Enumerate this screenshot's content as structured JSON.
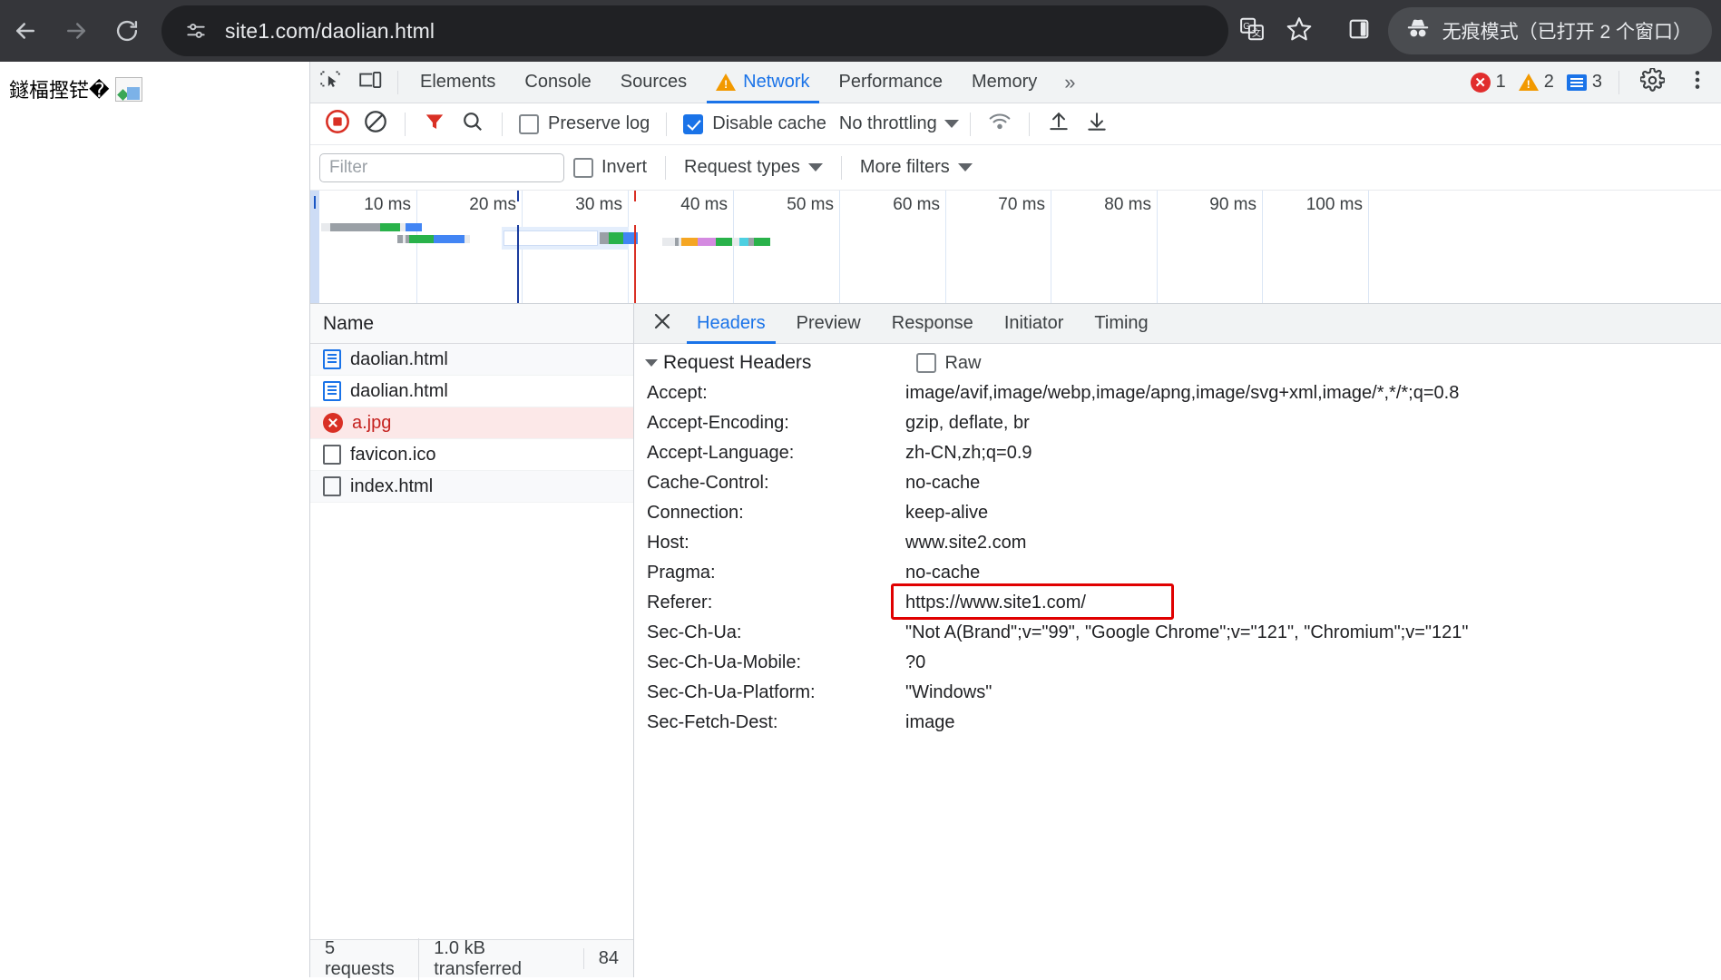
{
  "browser": {
    "back_icon": "back-arrow-icon",
    "forward_icon": "forward-arrow-icon",
    "reload_icon": "reload-icon",
    "site_info_icon": "tune-icon",
    "url": "site1.com/daolian.html",
    "translate_icon": "translate-icon",
    "bookmark_icon": "star-icon",
    "sidepanel_icon": "side-panel-icon",
    "incognito_icon": "incognito-icon",
    "incognito_label": "无痕模式（已打开 2 个窗口）"
  },
  "page": {
    "text": "鐩楅摼铓�",
    "broken_image_alt": "broken-image"
  },
  "devtools": {
    "inspect_icon": "inspect-element-icon",
    "device_icon": "device-toolbar-icon",
    "tabs": [
      {
        "label": "Elements",
        "active": false,
        "warn": false
      },
      {
        "label": "Console",
        "active": false,
        "warn": false
      },
      {
        "label": "Sources",
        "active": false,
        "warn": false
      },
      {
        "label": "Network",
        "active": true,
        "warn": true
      },
      {
        "label": "Performance",
        "active": false,
        "warn": false
      },
      {
        "label": "Memory",
        "active": false,
        "warn": false
      }
    ],
    "more_tabs": "»",
    "counters": {
      "errors": "1",
      "warnings": "2",
      "infos": "3"
    },
    "settings_icon": "gear-icon",
    "menu_icon": "kebab-menu-icon",
    "colors": {
      "accent": "#1a73e8",
      "error": "#d93025",
      "warning": "#f29900"
    }
  },
  "network_toolbar": {
    "record_icon": "record-stop-icon",
    "clear_icon": "clear-icon",
    "filter_icon": "filter-funnel-icon",
    "search_icon": "search-icon",
    "preserve_log": {
      "label": "Preserve log",
      "checked": false
    },
    "disable_cache": {
      "label": "Disable cache",
      "checked": true
    },
    "throttling": "No throttling",
    "throttle_caret": "chevron-down-icon",
    "wifi_icon": "network-conditions-icon",
    "import_icon": "upload-har-icon",
    "export_icon": "download-har-icon"
  },
  "filter_row": {
    "filter_placeholder": "Filter",
    "filter_value": "",
    "invert": {
      "label": "Invert",
      "checked": false
    },
    "request_types": "Request types",
    "more_filters": "More filters"
  },
  "overview": {
    "ticks": [
      "10 ms",
      "20 ms",
      "30 ms",
      "40 ms",
      "50 ms",
      "60 ms",
      "70 ms",
      "80 ms",
      "90 ms",
      "100 ms"
    ],
    "dcl_color": "#1a3c9e",
    "load_color": "#d93025"
  },
  "request_list": {
    "column_header": "Name",
    "rows": [
      {
        "name": "daolian.html",
        "icon": "document-icon",
        "state": "normal"
      },
      {
        "name": "daolian.html",
        "icon": "document-icon",
        "state": "normal"
      },
      {
        "name": "a.jpg",
        "icon": "error-icon",
        "state": "error"
      },
      {
        "name": "favicon.ico",
        "icon": "blank-file-icon",
        "state": "normal"
      },
      {
        "name": "index.html",
        "icon": "blank-file-icon",
        "state": "normal"
      }
    ],
    "status": {
      "requests": "5 requests",
      "transferred": "1.0 kB transferred",
      "resources": "84"
    }
  },
  "detail": {
    "close_icon": "close-icon",
    "tabs": [
      {
        "label": "Headers",
        "active": true
      },
      {
        "label": "Preview",
        "active": false
      },
      {
        "label": "Response",
        "active": false
      },
      {
        "label": "Initiator",
        "active": false
      },
      {
        "label": "Timing",
        "active": false
      }
    ],
    "section_title": "Request Headers",
    "raw": {
      "label": "Raw",
      "checked": false
    },
    "headers": [
      {
        "name": "Accept:",
        "value": "image/avif,image/webp,image/apng,image/svg+xml,image/*,*/*;q=0.8",
        "highlight": false
      },
      {
        "name": "Accept-Encoding:",
        "value": "gzip, deflate, br",
        "highlight": false
      },
      {
        "name": "Accept-Language:",
        "value": "zh-CN,zh;q=0.9",
        "highlight": false
      },
      {
        "name": "Cache-Control:",
        "value": "no-cache",
        "highlight": false
      },
      {
        "name": "Connection:",
        "value": "keep-alive",
        "highlight": false
      },
      {
        "name": "Host:",
        "value": "www.site2.com",
        "highlight": false
      },
      {
        "name": "Pragma:",
        "value": "no-cache",
        "highlight": false
      },
      {
        "name": "Referer:",
        "value": "https://www.site1.com/",
        "highlight": true
      },
      {
        "name": "Sec-Ch-Ua:",
        "value": "\"Not A(Brand\";v=\"99\", \"Google Chrome\";v=\"121\", \"Chromium\";v=\"121\"",
        "highlight": false
      },
      {
        "name": "Sec-Ch-Ua-Mobile:",
        "value": "?0",
        "highlight": false
      },
      {
        "name": "Sec-Ch-Ua-Platform:",
        "value": "\"Windows\"",
        "highlight": false
      },
      {
        "name": "Sec-Fetch-Dest:",
        "value": "image",
        "highlight": false
      }
    ],
    "highlight_color": "#e00000"
  }
}
